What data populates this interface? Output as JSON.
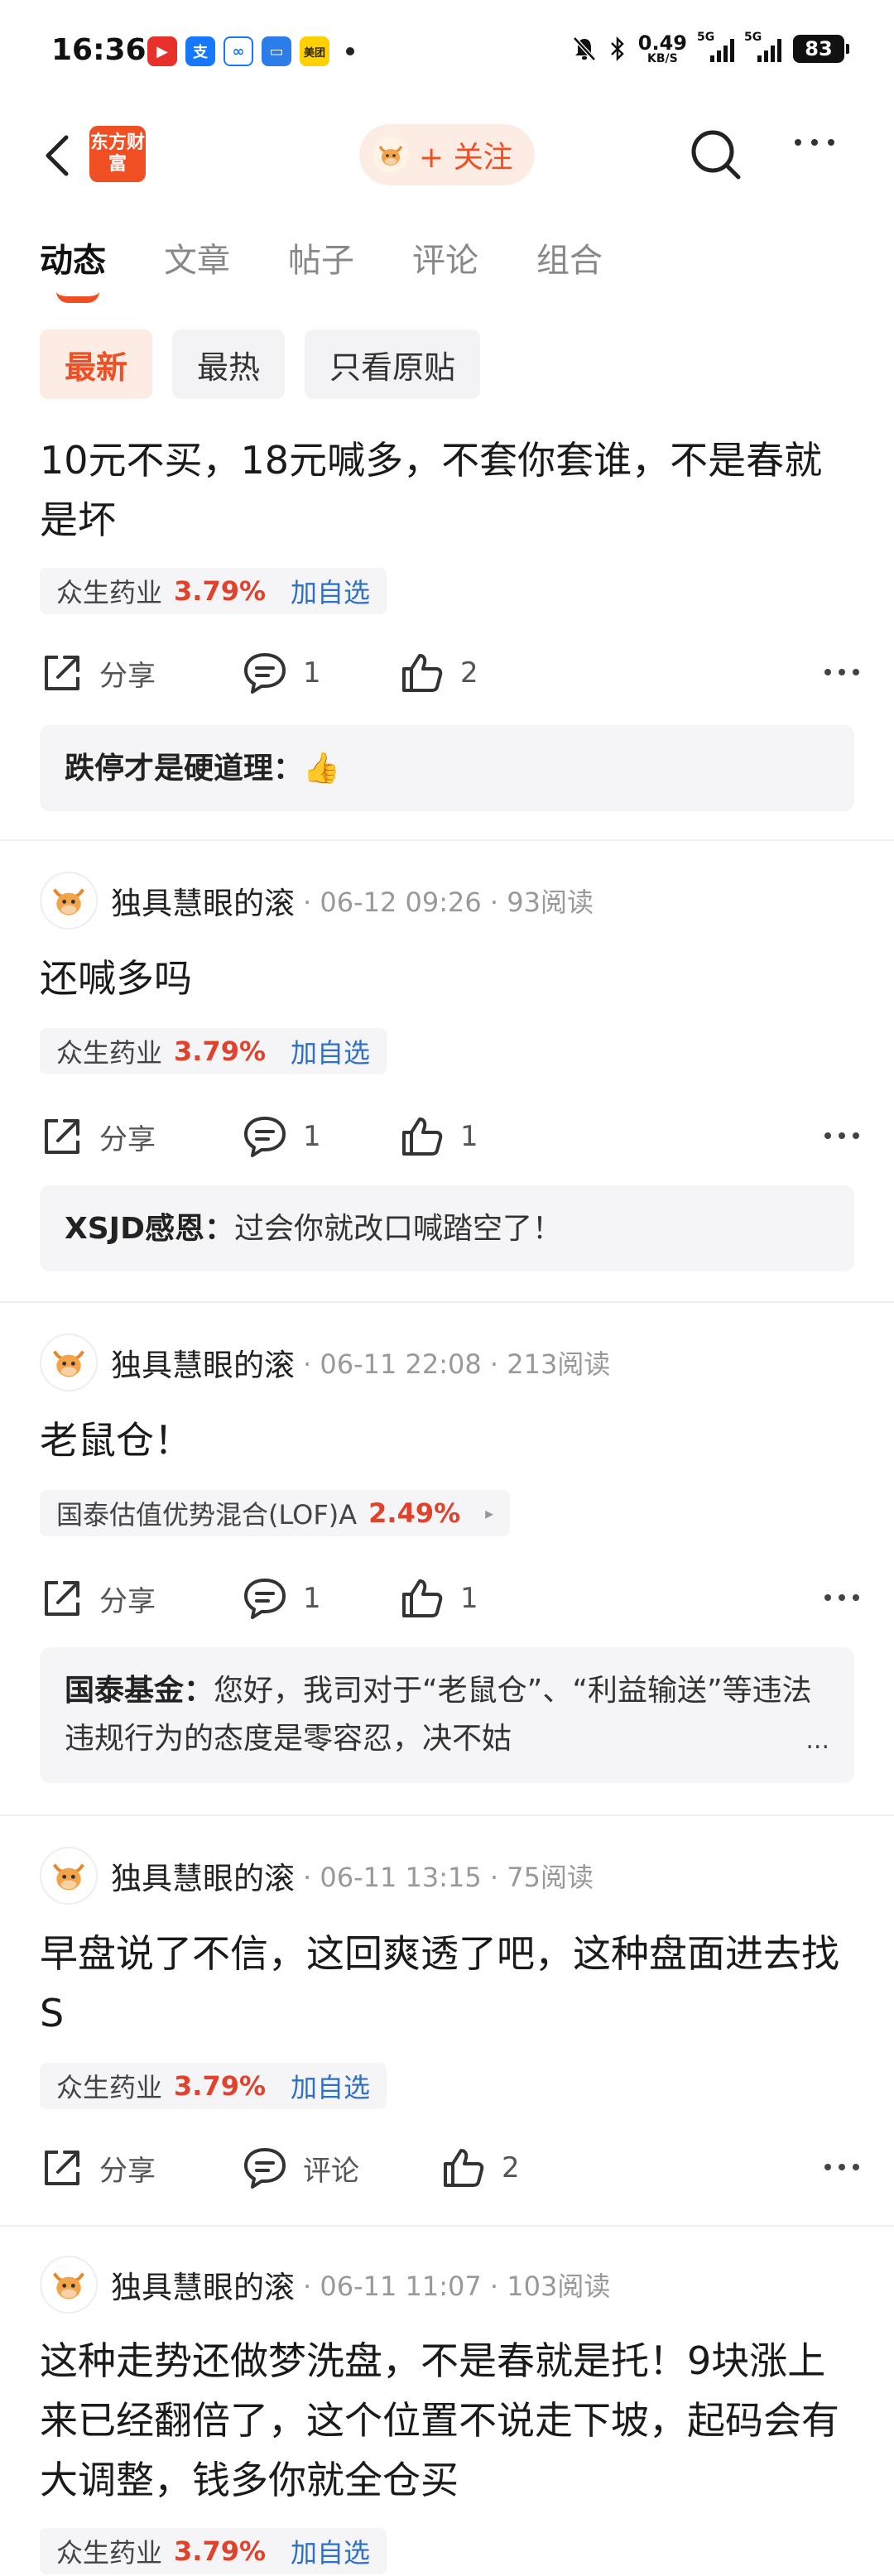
{
  "status_bar": {
    "time": "16:36",
    "net_speed_value": "0.49",
    "net_speed_unit": "KB/S",
    "signal1_label": "5G",
    "signal2_label": "5G",
    "battery": "83",
    "app_icons": [
      "video-app-icon",
      "alipay-icon",
      "cloud-app-icon",
      "calendar-app-icon",
      "meituan-icon"
    ],
    "meituan_label": "美团"
  },
  "nav": {
    "logo_text": "东方财富",
    "follow_label": "+ 关注"
  },
  "tabs": [
    {
      "label": "动态",
      "active": true
    },
    {
      "label": "文章",
      "active": false
    },
    {
      "label": "帖子",
      "active": false
    },
    {
      "label": "评论",
      "active": false
    },
    {
      "label": "组合",
      "active": false
    }
  ],
  "filters": [
    {
      "label": "最新",
      "active": true
    },
    {
      "label": "最热",
      "active": false
    },
    {
      "label": "只看原贴",
      "active": false
    }
  ],
  "posts": [
    {
      "text": "10元不买，18元喊多，不套你套谁，不是春就是坏",
      "stock": {
        "name": "众生药业",
        "pct": "3.79%",
        "add": "加自选"
      },
      "share": "分享",
      "comments": "1",
      "likes": "2",
      "reply": {
        "author": "跌停才是硬道理：",
        "content": "👍"
      }
    },
    {
      "author": "独具慧眼的滚",
      "date": "06-12 09:26",
      "reads": "93阅读",
      "text": "还喊多吗",
      "stock": {
        "name": "众生药业",
        "pct": "3.79%",
        "add": "加自选"
      },
      "share": "分享",
      "comments": "1",
      "likes": "1",
      "reply": {
        "author": "XSJD感恩：",
        "content": "过会你就改口喊踏空了！"
      }
    },
    {
      "author": "独具慧眼的滚",
      "date": "06-11 22:08",
      "reads": "213阅读",
      "text": "老鼠仓！",
      "stock": {
        "name": "国泰估值优势混合(LOF)A",
        "pct": "2.49%",
        "arrow": "▸"
      },
      "share": "分享",
      "comments": "1",
      "likes": "1",
      "reply": {
        "author": "国泰基金：",
        "content": "您好，我司对于“老鼠仓”、“利益输送”等违法违规行为的态度是零容忍，决不姑",
        "ellipsis": "..."
      }
    },
    {
      "author": "独具慧眼的滚",
      "date": "06-11 13:15",
      "reads": "75阅读",
      "text": "早盘说了不信，这回爽透了吧，这种盘面进去找S",
      "stock": {
        "name": "众生药业",
        "pct": "3.79%",
        "add": "加自选"
      },
      "share": "分享",
      "comments": "评论",
      "likes": "2"
    },
    {
      "author": "独具慧眼的滚",
      "date": "06-11 11:07",
      "reads": "103阅读",
      "text": "这种走势还做梦洗盘，不是春就是托！9块涨上来已经翻倍了，这个位置不说走下坡，起码会有大调整，钱多你就全仓买",
      "stock": {
        "name": "众生药业",
        "pct": "3.79%",
        "add": "加自选"
      }
    }
  ],
  "colors": {
    "accent": "#f04e23",
    "rise": "#e1422b",
    "link": "#2f6fc4"
  }
}
